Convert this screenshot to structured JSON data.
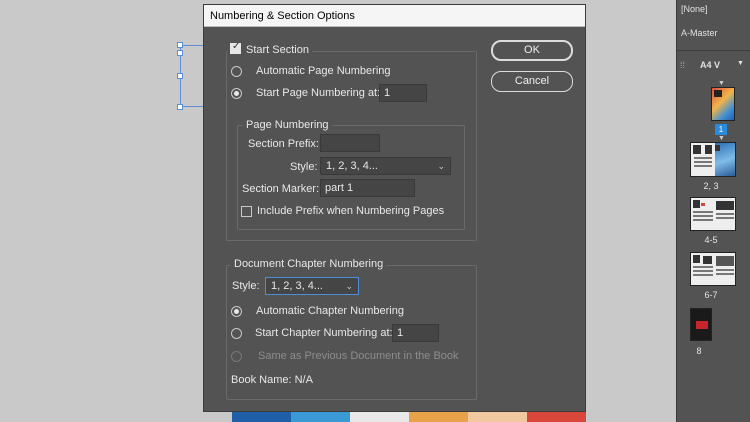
{
  "dialog": {
    "title": "Numbering & Section Options",
    "start_section": {
      "label": "Start Section",
      "checked": true
    },
    "auto_page_numbering": {
      "label": "Automatic Page Numbering",
      "selected": false
    },
    "start_page_numbering": {
      "label": "Start Page Numbering at:",
      "selected": true,
      "value": "1"
    },
    "page_numbering_group": {
      "legend": "Page Numbering",
      "section_prefix_label": "Section Prefix:",
      "section_prefix_value": "",
      "style_label": "Style:",
      "style_value": "1, 2, 3, 4...",
      "section_marker_label": "Section Marker:",
      "section_marker_value": "part 1",
      "include_prefix": {
        "label": "Include Prefix when Numbering Pages",
        "checked": false
      }
    },
    "chapter_group": {
      "legend": "Document Chapter Numbering",
      "style_label": "Style:",
      "style_value": "1, 2, 3, 4...",
      "auto_chapter": {
        "label": "Automatic Chapter Numbering",
        "selected": true
      },
      "start_chapter": {
        "label": "Start Chapter Numbering at:",
        "selected": false,
        "value": "1"
      },
      "same_as_previous": {
        "label": "Same as Previous Document in the Book",
        "enabled": false
      },
      "book_name": "Book Name: N/A"
    },
    "buttons": {
      "ok": "OK",
      "cancel": "Cancel"
    }
  },
  "pages_panel": {
    "none_label": "[None]",
    "master_label": "A-Master",
    "page_size": "A4 V",
    "current_page_badge": "1",
    "spreads": [
      "2, 3",
      "4-5",
      "6-7",
      "8"
    ],
    "accent_color": "#2a8bdc"
  }
}
